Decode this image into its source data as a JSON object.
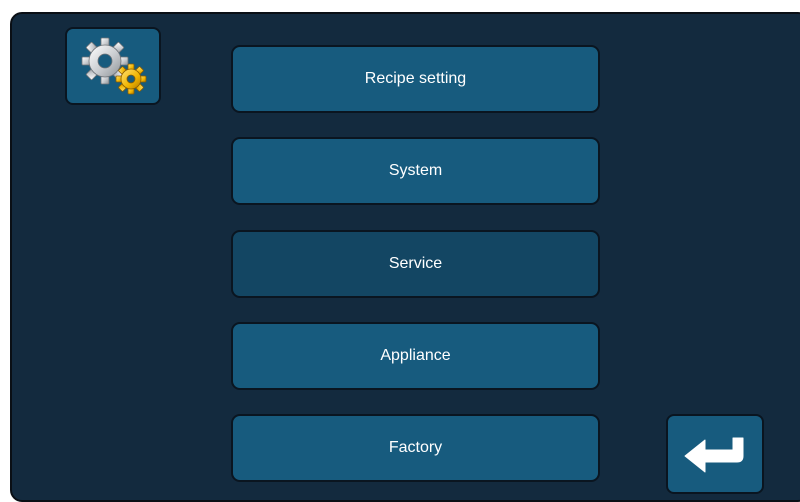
{
  "colors": {
    "background": "#132a3e",
    "button": "#175b7e",
    "button_dim": "#134663",
    "border": "#0a1520",
    "text": "#ffffff"
  },
  "header": {
    "icon": "settings-gears-icon"
  },
  "menu": {
    "items": [
      {
        "label": "Recipe setting"
      },
      {
        "label": "System"
      },
      {
        "label": "Service"
      },
      {
        "label": "Appliance"
      },
      {
        "label": "Factory"
      }
    ]
  },
  "footer": {
    "back_icon": "return-arrow-icon"
  }
}
